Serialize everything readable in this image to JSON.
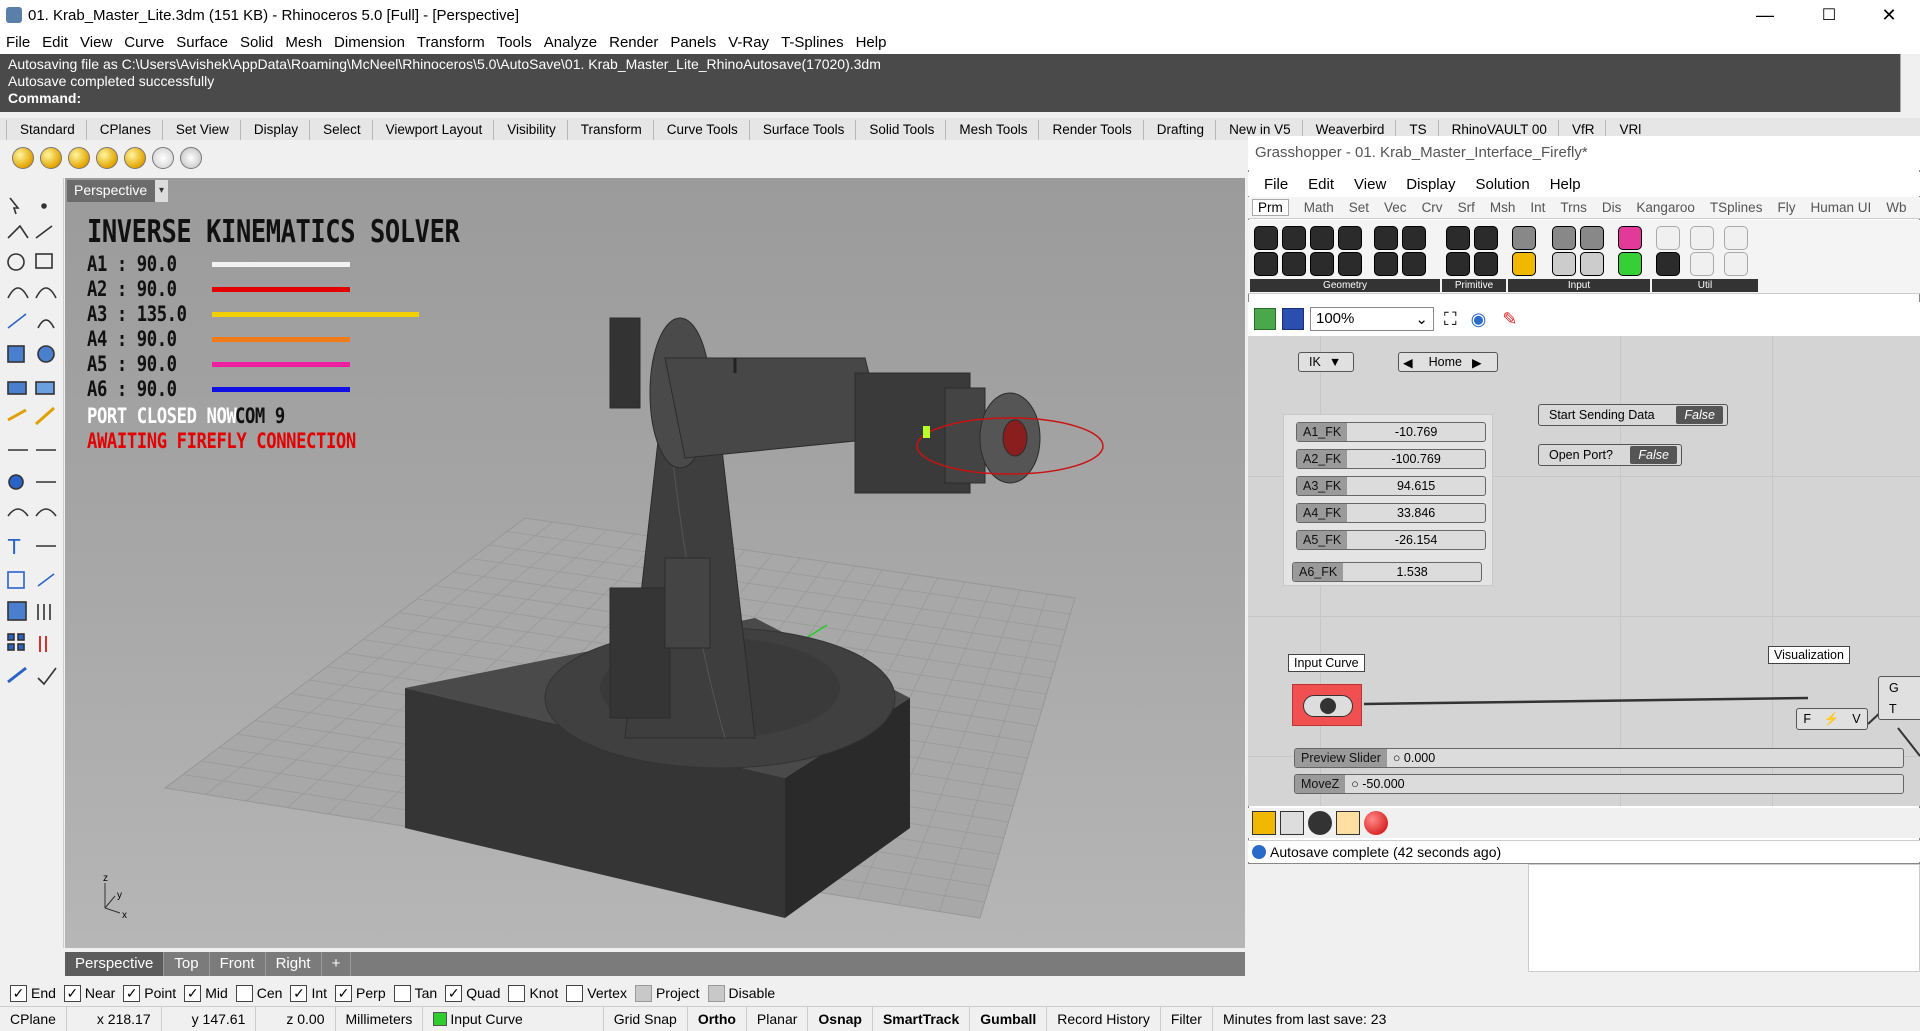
{
  "window": {
    "title": "01. Krab_Master_Lite.3dm (151 KB) - Rhinoceros 5.0 [Full] - [Perspective]",
    "minimize": "—",
    "maximize": "☐",
    "close": "✕"
  },
  "menu": [
    "File",
    "Edit",
    "View",
    "Curve",
    "Surface",
    "Solid",
    "Mesh",
    "Dimension",
    "Transform",
    "Tools",
    "Analyze",
    "Render",
    "Panels",
    "V-Ray",
    "T-Splines",
    "Help"
  ],
  "command": {
    "line1": "Autosaving file as C:\\Users\\Avishek\\AppData\\Roaming\\McNeel\\Rhinoceros\\5.0\\AutoSave\\01. Krab_Master_Lite_RhinoAutosave(17020).3dm",
    "line2": "Autosave completed successfully",
    "prompt": "Command:"
  },
  "toolbar_tabs": [
    "Standard",
    "CPlanes",
    "Set View",
    "Display",
    "Select",
    "Viewport Layout",
    "Visibility",
    "Transform",
    "Curve Tools",
    "Surface Tools",
    "Solid Tools",
    "Mesh Tools",
    "Render Tools",
    "Drafting",
    "New in V5",
    "Weaverbird",
    "TS",
    "RhinoVAULT 00",
    "VfR",
    "VRl"
  ],
  "viewport": {
    "name": "Perspective",
    "arrow": "▾",
    "axis_z": "z",
    "axis_x": "x",
    "axis_y": "y"
  },
  "ik": {
    "title": "INVERSE KINEMATICS SOLVER",
    "axes": [
      {
        "label": "A1 : 90.0",
        "color": "#f2f2f2",
        "fill": 0.6
      },
      {
        "label": "A2 : 90.0",
        "color": "#e30000",
        "fill": 0.6
      },
      {
        "label": "A3 : 135.0",
        "color": "#f5d000",
        "fill": 0.9
      },
      {
        "label": "A4 : 90.0",
        "color": "#f07b18",
        "fill": 0.6
      },
      {
        "label": "A5 : 90.0",
        "color": "#ee1fa0",
        "fill": 0.6
      },
      {
        "label": "A6 : 90.0",
        "color": "#1010e6",
        "fill": 0.6
      }
    ],
    "port_status": "PORT CLOSED NOW",
    "com": "COM 9",
    "firefly": "AWAITING FIREFLY CONNECTION"
  },
  "viewport_tabs": [
    "Perspective",
    "Top",
    "Front",
    "Right",
    "+"
  ],
  "osnap": [
    {
      "label": "End",
      "checked": true
    },
    {
      "label": "Near",
      "checked": true
    },
    {
      "label": "Point",
      "checked": true
    },
    {
      "label": "Mid",
      "checked": true
    },
    {
      "label": "Cen",
      "checked": false
    },
    {
      "label": "Int",
      "checked": true
    },
    {
      "label": "Perp",
      "checked": true
    },
    {
      "label": "Tan",
      "checked": false
    },
    {
      "label": "Quad",
      "checked": true
    },
    {
      "label": "Knot",
      "checked": false
    },
    {
      "label": "Vertex",
      "checked": false
    },
    {
      "label": "Project",
      "checked": false
    },
    {
      "label": "Disable",
      "checked": false
    }
  ],
  "status": {
    "cplane": "CPlane",
    "x": "x 218.17",
    "y": "y 147.61",
    "z": "z 0.00",
    "units": "Millimeters",
    "layer": "Input Curve",
    "grid": "Grid Snap",
    "ortho": "Ortho",
    "planar": "Planar",
    "osnap": "Osnap",
    "smarttrack": "SmartTrack",
    "gumball": "Gumball",
    "history": "Record History",
    "filter": "Filter",
    "minutes": "Minutes from last save: 23"
  },
  "gh": {
    "title": "Grasshopper - 01. Krab_Master_Interface_Firefly*",
    "menu": [
      "File",
      "Edit",
      "View",
      "Display",
      "Solution",
      "Help"
    ],
    "tabs": [
      "Prm",
      "Math",
      "Set",
      "Vec",
      "Crv",
      "Srf",
      "Msh",
      "Int",
      "Trns",
      "Dis",
      "Kangaroo",
      "TSplines",
      "Fly",
      "Human UI",
      "Wb"
    ],
    "groups": [
      "Geometry",
      "Primitive",
      "Input",
      "Util"
    ],
    "zoom": "100%",
    "ik_label": "IK",
    "home_label": "Home",
    "sliders": [
      {
        "name": "A1_FK",
        "value": "-10.769"
      },
      {
        "name": "A2_FK",
        "value": "-100.769"
      },
      {
        "name": "A3_FK",
        "value": "94.615"
      },
      {
        "name": "A4_FK",
        "value": "33.846"
      },
      {
        "name": "A5_FK",
        "value": "-26.154"
      },
      {
        "name": "A6_FK",
        "value": "1.538"
      }
    ],
    "start_sending": {
      "label": "Start Sending Data",
      "value": "False"
    },
    "open_port": {
      "label": "Open Port?",
      "value": "False"
    },
    "input_curve": "Input Curve",
    "visualization": "Visualization",
    "preview_slider": {
      "name": "Preview Slider",
      "value": "0.000"
    },
    "movez": {
      "name": "MoveZ",
      "value": "-50.000"
    },
    "fzv": {
      "f": "F",
      "v": "V"
    },
    "gt": {
      "g": "G",
      "t": "T"
    },
    "status": "Autosave complete (42 seconds ago)"
  },
  "colors": {
    "accent_red": "#e30000",
    "node_red": "#f05050",
    "cmd_bg": "#4a4a4a"
  }
}
